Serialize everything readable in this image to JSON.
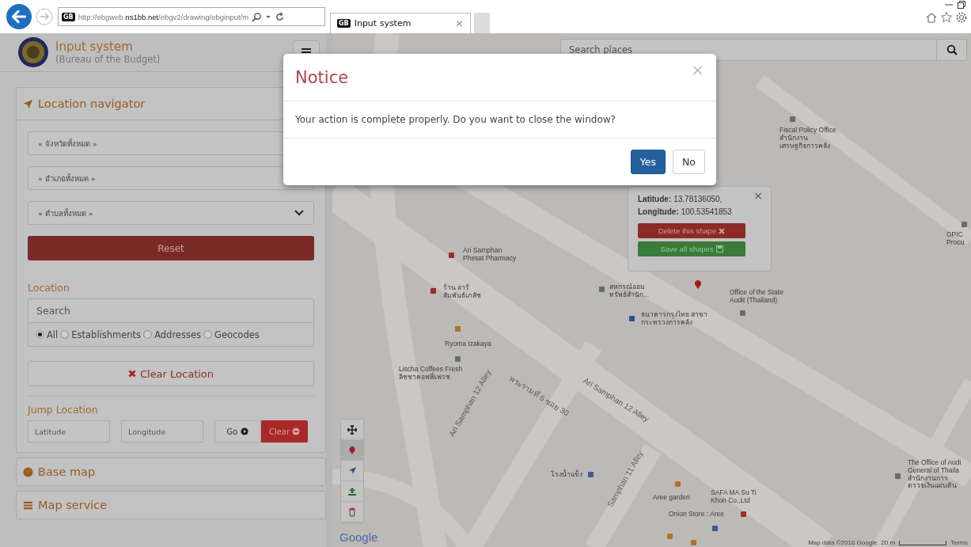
{
  "browser": {
    "url": "http://ebgweb.**ns1bb.net**/ebgv2/drawing/ebginput/m",
    "favicon": "GB",
    "tab": {
      "favicon": "GB",
      "title": "Input system",
      "close": "×"
    }
  },
  "header": {
    "title": "Input system",
    "subtitle": "(Bureau of the Budget)"
  },
  "panels": [
    {
      "title": "Location navigator",
      "expanded": true
    },
    {
      "title": "Base map",
      "expanded": false
    },
    {
      "title": "Map service",
      "expanded": false
    }
  ],
  "navigator": {
    "selects": [
      "« จังหวัดทั้งหมด »",
      "« อำเภอทั้งหมด »",
      "« ตำบลทั้งหมด »"
    ],
    "reset": "Reset",
    "location_label": "Location",
    "search": {
      "placeholder": "Search"
    },
    "search_types": [
      {
        "label": "All",
        "selected": true
      },
      {
        "label": "Establishments",
        "selected": false
      },
      {
        "label": "Addresses",
        "selected": false
      },
      {
        "label": "Geocodes",
        "selected": false
      }
    ],
    "clear_location": "Clear Location",
    "jump_label": "Jump Location",
    "latitude": {
      "placeholder": "Latitude"
    },
    "longitude": {
      "placeholder": "Longitude"
    },
    "go": "Go",
    "clear": "Clear"
  },
  "map": {
    "search": {
      "placeholder": "Search places"
    },
    "labels": [
      {
        "kind": "place",
        "text": "Fiscal Policy Office\nสำนักงาน\nเศรษฐกิจการคลัง"
      },
      {
        "kind": "place",
        "text": "GPIC\nProcu"
      },
      {
        "kind": "place",
        "text": "Ari Samphan\nPhesat Pharmacy"
      },
      {
        "kind": "place",
        "text": "ร้าน อารี\nสัมพันธ์เภสัช"
      },
      {
        "kind": "place",
        "text": "สหกรณ์ออม\nทรัพย์สำนัก..."
      },
      {
        "kind": "place",
        "text": "Office of the State\nAudit (Thailand)"
      },
      {
        "kind": "place",
        "text": "ธนาคารกรุงไทย สาขา\nกระทรวงการคลัง"
      },
      {
        "kind": "place",
        "text": "Ryoma Izakaya"
      },
      {
        "kind": "place",
        "text": "Lischa Coffees Fresh\nลิชชาคอฟฟี่เฟรช"
      },
      {
        "kind": "place",
        "text": "โรงน้ำแข็ง"
      },
      {
        "kind": "place",
        "text": "Aree garden"
      },
      {
        "kind": "place",
        "text": "SAFA MA Su Ti\nKhon Co.,Ltd"
      },
      {
        "kind": "place",
        "text": "Onion Store : Aree"
      },
      {
        "kind": "place",
        "text": "The Office of Audi\nGeneral of Thaila\nสำนักงานการ\nตรวจเงินแผ่นดิน"
      },
      {
        "kind": "road",
        "text": "พระรามที่ 6 ซอย 30"
      },
      {
        "kind": "road",
        "text": "Ari Samphan 12 Alley"
      },
      {
        "kind": "road",
        "text": "Ari Samphan 12 Alley"
      },
      {
        "kind": "road",
        "text": "Samphan 11 Alley"
      }
    ],
    "popup": {
      "latitude_label": "Latitude:",
      "latitude": "13.78136050,",
      "longitude_label": "Longitude:",
      "longitude": "100.53541853",
      "close": "×",
      "delete": "Delete this shape",
      "save": "Save all shapes"
    },
    "tools": [
      {
        "selected": false
      },
      {
        "selected": true
      },
      {
        "selected": false
      },
      {
        "selected": false
      },
      {
        "selected": false
      }
    ],
    "logo": "Google",
    "attribution": "Map data ©2016 Google",
    "scale": "20 m",
    "terms": "Terms"
  },
  "modal": {
    "title": "Notice",
    "close": "×",
    "message": "Your action is complete properly. Do you want to close the window?",
    "buttons": [
      {
        "label": "Yes",
        "kind": "primary"
      },
      {
        "label": "No",
        "kind": "default"
      }
    ]
  }
}
